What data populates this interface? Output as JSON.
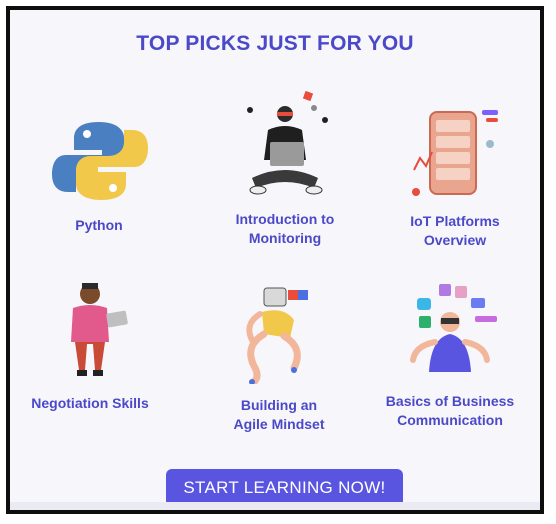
{
  "header": {
    "title": "TOP PICKS JUST FOR YOU"
  },
  "courses": [
    {
      "label": "Python",
      "icon": "python-logo-icon"
    },
    {
      "label": "Introduction to\nMonitoring",
      "icon": "laptop-person-icon"
    },
    {
      "label": "IoT Platforms\nOverview",
      "icon": "iot-phone-icon"
    },
    {
      "label": "Negotiation Skills",
      "icon": "person-laptop-icon"
    },
    {
      "label": "Building an\nAgile Mindset",
      "icon": "agile-figure-icon"
    },
    {
      "label": "Basics of Business\nCommunication",
      "icon": "vr-communication-icon"
    }
  ],
  "cta": {
    "label": "START LEARNING NOW!"
  },
  "colors": {
    "accent": "#4b49c8",
    "button": "#5a55e0",
    "background": "#f6f6fb"
  }
}
